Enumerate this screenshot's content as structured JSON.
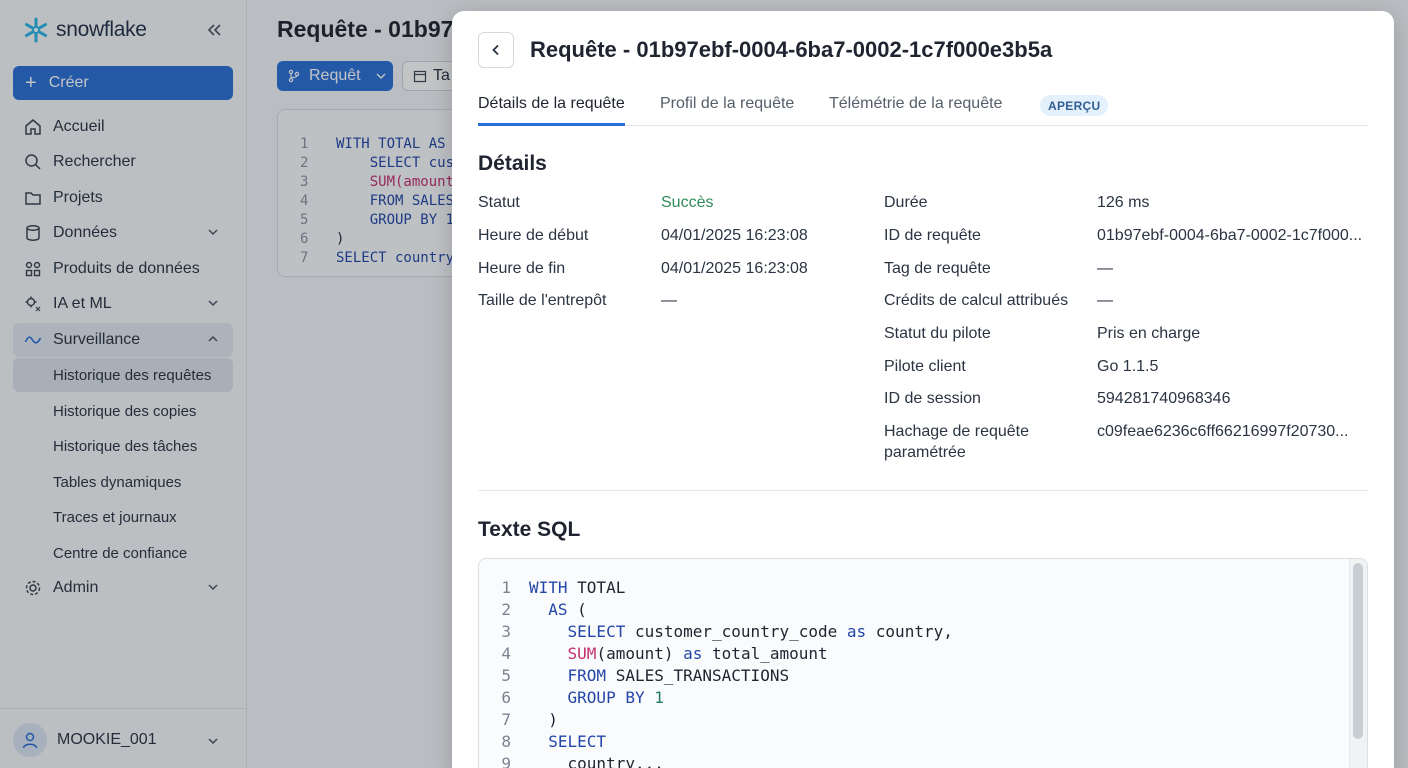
{
  "sidebar": {
    "brand": "snowflake",
    "create_label": "Créer",
    "items": [
      {
        "label": "Accueil"
      },
      {
        "label": "Rechercher"
      },
      {
        "label": "Projets"
      },
      {
        "label": "Données"
      },
      {
        "label": "Produits de données"
      },
      {
        "label": "IA et ML"
      },
      {
        "label": "Surveillance"
      },
      {
        "label": "Admin"
      }
    ],
    "subitems": [
      {
        "label": "Historique des requêtes"
      },
      {
        "label": "Historique des copies"
      },
      {
        "label": "Historique des tâches"
      },
      {
        "label": "Tables dynamiques"
      },
      {
        "label": "Traces et journaux"
      },
      {
        "label": "Centre de confiance"
      }
    ],
    "user": "MOOKIE_001"
  },
  "background": {
    "title": "Requête - 01b97e",
    "query_button": "Requêt",
    "tab_button": "Ta",
    "code": [
      {
        "n": "1",
        "text": "WITH TOTAL AS "
      },
      {
        "n": "2",
        "text": "    SELECT cus"
      },
      {
        "n": "3",
        "text": "    SUM(amount"
      },
      {
        "n": "4",
        "text": "    FROM SALES"
      },
      {
        "n": "5",
        "text": "    GROUP BY 1"
      },
      {
        "n": "6",
        "text": ")"
      },
      {
        "n": "7",
        "text": "SELECT country"
      }
    ]
  },
  "panel": {
    "title": "Requête - 01b97ebf-0004-6ba7-0002-1c7f000e3b5a",
    "tabs": [
      {
        "label": "Détails de la requête"
      },
      {
        "label": "Profil de la requête"
      },
      {
        "label": "Télémétrie de la requête"
      }
    ],
    "preview_badge": "APERÇU",
    "details_title": "Détails",
    "left_details": [
      {
        "label": "Statut",
        "value": "Succès"
      },
      {
        "label": "Heure de début",
        "value": "04/01/2025 16:23:08"
      },
      {
        "label": "Heure de fin",
        "value": "04/01/2025 16:23:08"
      },
      {
        "label": "Taille de l'entrepôt",
        "value": "—"
      }
    ],
    "right_details": [
      {
        "label": "Durée",
        "value": "126 ms"
      },
      {
        "label": "ID de requête",
        "value": "01b97ebf-0004-6ba7-0002-1c7f000..."
      },
      {
        "label": "Tag de requête",
        "value": "—"
      },
      {
        "label": "Crédits de calcul attribués",
        "value": "—"
      },
      {
        "label": "Statut du pilote",
        "value": "Pris en charge"
      },
      {
        "label": "Pilote client",
        "value": "Go 1.1.5"
      },
      {
        "label": "ID de session",
        "value": "594281740968346"
      },
      {
        "label": "Hachage de requête",
        "label2": "paramétrée",
        "value": "c09feae6236c6ff66216997f20730..."
      }
    ],
    "sql_title": "Texte SQL",
    "sql_lines": [
      {
        "n": "1",
        "indent": "",
        "tokens": [
          [
            "kw",
            "WITH"
          ],
          [
            "",
            "TOTAL"
          ]
        ]
      },
      {
        "n": "2",
        "indent": "  ",
        "tokens": [
          [
            "kw",
            "AS"
          ],
          [
            "",
            "("
          ]
        ]
      },
      {
        "n": "3",
        "indent": "    ",
        "tokens": [
          [
            "kw",
            "SELECT"
          ],
          [
            "",
            "customer_country_code"
          ],
          [
            "kw",
            "as"
          ],
          [
            "",
            "country,"
          ]
        ]
      },
      {
        "n": "4",
        "indent": "    ",
        "tokens": [
          [
            "fn",
            "SUM"
          ],
          [
            "",
            "(amount)"
          ],
          [
            "kw",
            "as"
          ],
          [
            "",
            "total_amount"
          ]
        ]
      },
      {
        "n": "5",
        "indent": "    ",
        "tokens": [
          [
            "kw",
            "FROM"
          ],
          [
            "",
            "SALES_TRANSACTIONS"
          ]
        ]
      },
      {
        "n": "6",
        "indent": "    ",
        "tokens": [
          [
            "kw",
            "GROUP"
          ],
          [
            "kw",
            "BY"
          ],
          [
            "num",
            "1"
          ]
        ]
      },
      {
        "n": "7",
        "indent": "  ",
        "tokens": [
          [
            "",
            ")"
          ]
        ]
      },
      {
        "n": "8",
        "indent": "  ",
        "tokens": [
          [
            "kw",
            "SELECT"
          ]
        ]
      },
      {
        "n": "9",
        "indent": "    ",
        "tokens": [
          [
            "",
            "country..."
          ]
        ]
      }
    ]
  }
}
